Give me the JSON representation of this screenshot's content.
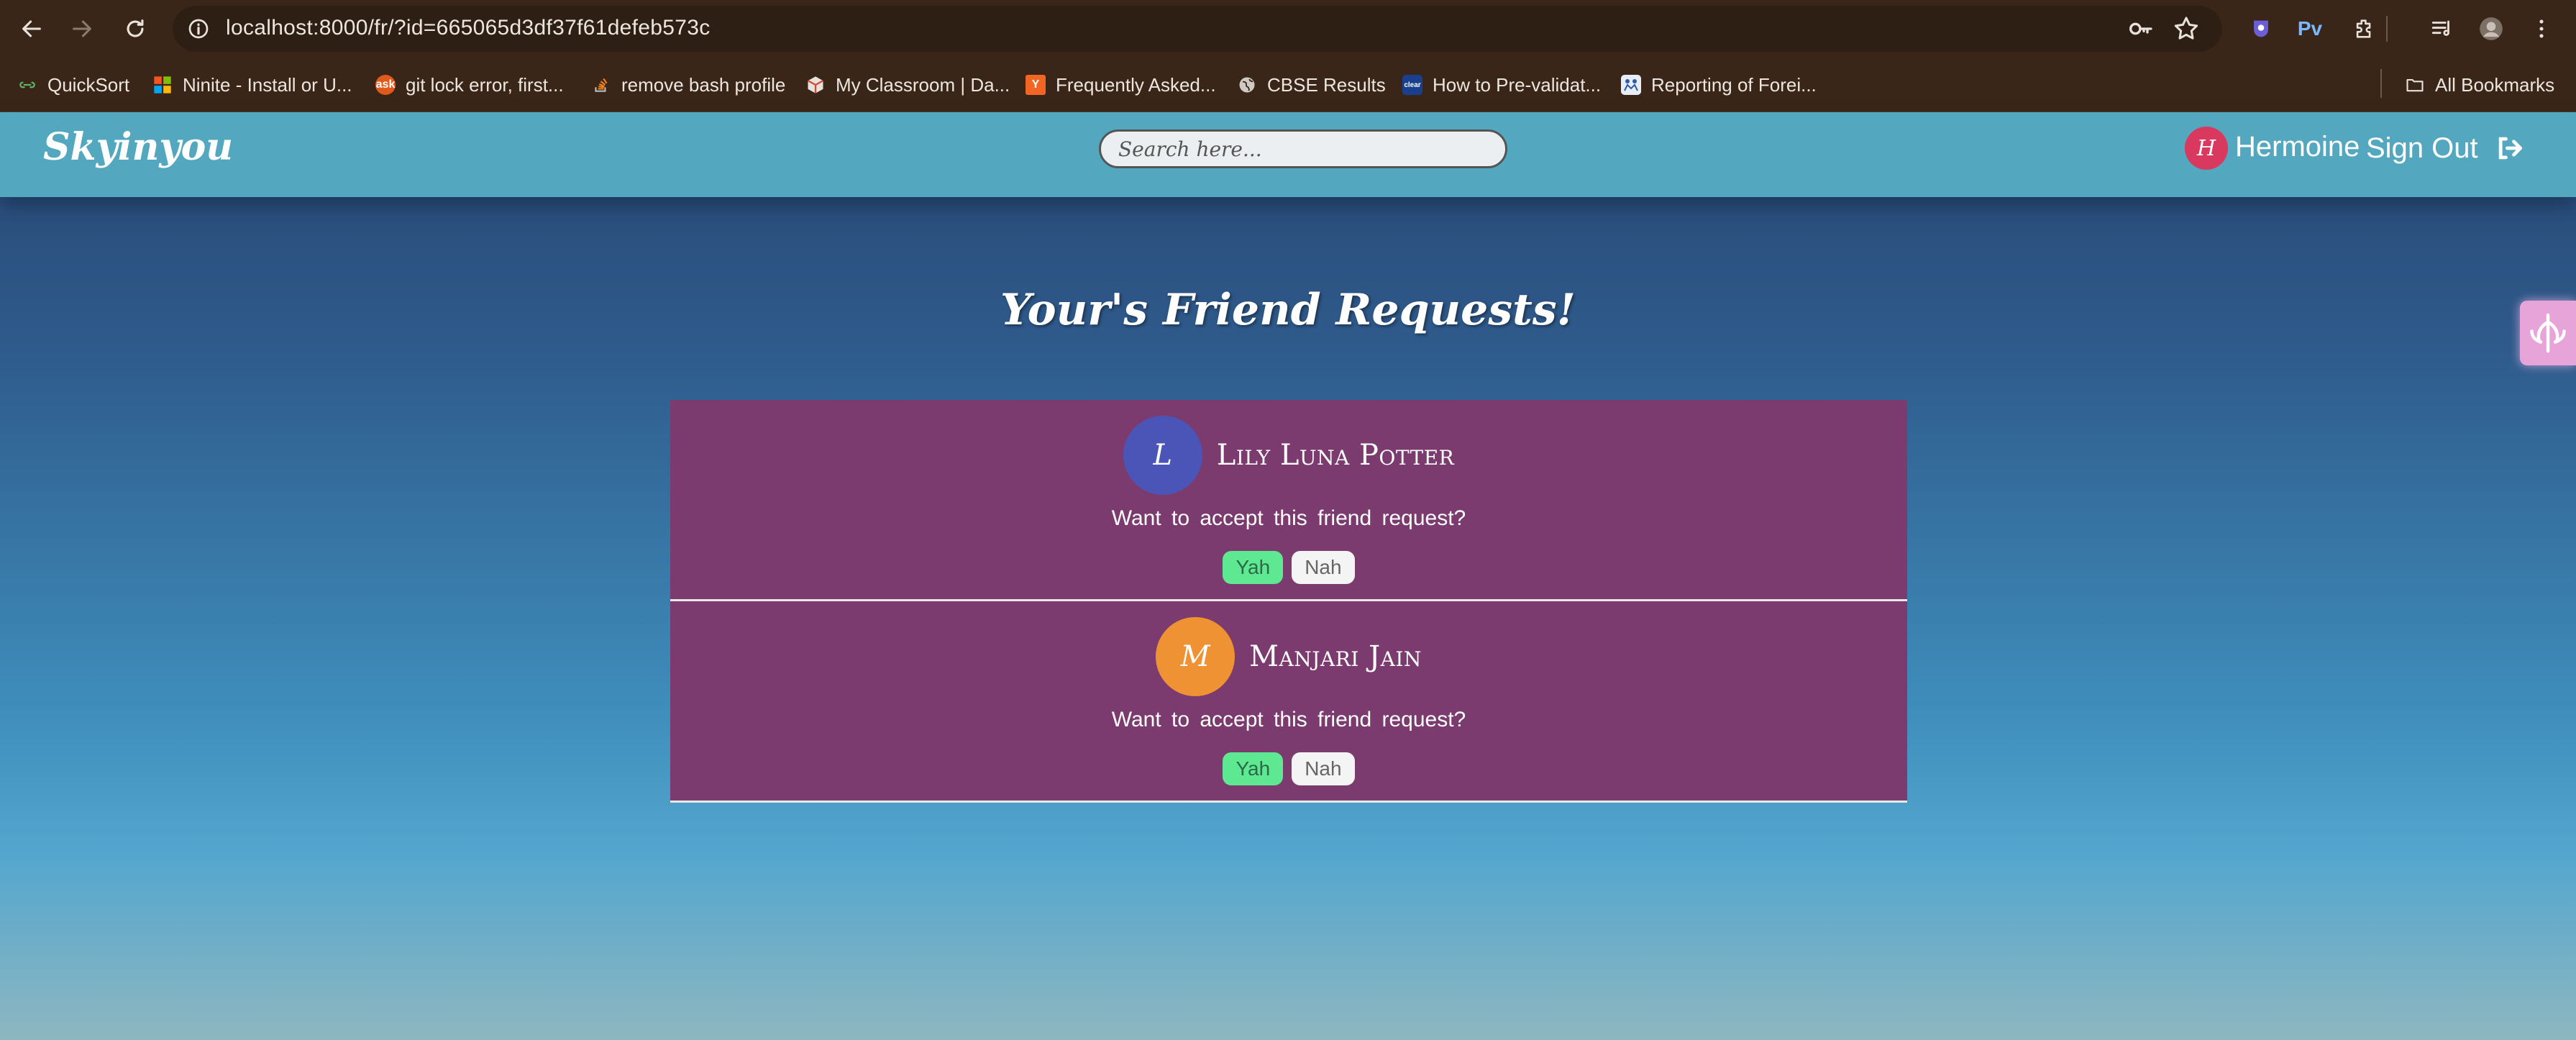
{
  "browser": {
    "url": "localhost:8000/fr/?id=665065d3df37f61defeb573c",
    "bookmarks": [
      {
        "label": "QuickSort",
        "icon": "link-icon",
        "color": "#3a2618"
      },
      {
        "label": "Ninite - Install or U...",
        "icon": "windows-icon",
        "color": "#f35325"
      },
      {
        "label": "git lock error, first...",
        "icon": "ask-icon",
        "color": "#e05a1c"
      },
      {
        "label": "remove bash profile",
        "icon": "stackoverflow-icon",
        "color": "#f48024"
      },
      {
        "label": "My Classroom | Da...",
        "icon": "box-icon",
        "color": "#d64a3a"
      },
      {
        "label": "Frequently Asked...",
        "icon": "y-icon",
        "color": "#f26522"
      },
      {
        "label": "CBSE Results",
        "icon": "globe-icon",
        "color": "#888888"
      },
      {
        "label": "How to Pre-validat...",
        "icon": "cleartax-icon",
        "color": "#1b3f8f"
      },
      {
        "label": "Reporting of Forei...",
        "icon": "org-icon",
        "color": "#2e5aa8"
      }
    ],
    "all_bookmarks": "All Bookmarks",
    "extensions": [
      "privacy-extension-icon",
      "pv-icon",
      "puzzle-icon",
      "media-icon",
      "profile-icon",
      "menu-icon"
    ],
    "pv_label": "Pv"
  },
  "app": {
    "brand": "Skyinyou",
    "search_placeholder": "Search here...",
    "user": {
      "initial": "H",
      "name": "Hermoine",
      "avatar_color": "#d9385f"
    },
    "signout_label": "Sign Out"
  },
  "page": {
    "heading": "Your's Friend Requests!",
    "requests": [
      {
        "initial": "L",
        "name": "Lily Luna Potter",
        "avatar_color": "#4b55b8",
        "prompt": "Want to accept this friend request?",
        "accept": "Yah",
        "reject": "Nah"
      },
      {
        "initial": "M",
        "name": "Manjari Jain",
        "avatar_color": "#ee9233",
        "prompt": "Want to accept this friend request?",
        "accept": "Yah",
        "reject": "Nah"
      }
    ]
  }
}
